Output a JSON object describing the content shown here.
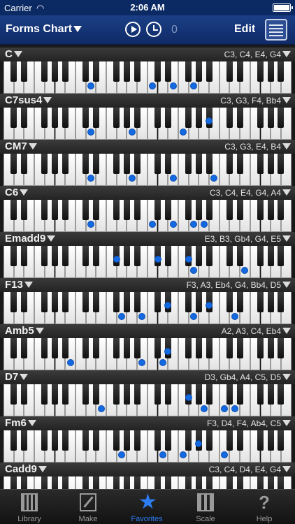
{
  "status_bar": {
    "carrier": "Carrier",
    "time": "2:06 AM"
  },
  "nav": {
    "title": "Forms Chart",
    "count": "0",
    "edit_label": "Edit"
  },
  "chords": [
    {
      "name": "C",
      "notes": "C3, C4, E4, G4",
      "keys": [
        14,
        24,
        28,
        31
      ]
    },
    {
      "name": "C7sus4",
      "notes": "C3, G3, F4, Bb4",
      "keys": [
        14,
        21,
        29,
        34
      ]
    },
    {
      "name": "CM7",
      "notes": "C3, G3, E4, B4",
      "keys": [
        14,
        21,
        28,
        35
      ]
    },
    {
      "name": "C6",
      "notes": "C3, C4, E4, G4, A4",
      "keys": [
        14,
        24,
        28,
        31,
        33
      ]
    },
    {
      "name": "Emadd9",
      "notes": "E3, B3, Gb4, G4, E5",
      "keys": [
        18,
        25,
        30,
        31,
        40
      ]
    },
    {
      "name": "F13",
      "notes": "F3, A3, Eb4, G4, Bb4, D5",
      "keys": [
        19,
        23,
        27,
        31,
        34,
        38
      ]
    },
    {
      "name": "Amb5",
      "notes": "A2, A3, C4, Eb4",
      "keys": [
        11,
        23,
        26,
        27
      ]
    },
    {
      "name": "D7",
      "notes": "D3, Gb4, A4, C5, D5",
      "keys": [
        16,
        30,
        33,
        36,
        38
      ]
    },
    {
      "name": "Fm6",
      "notes": "F3, D4, F4, Ab4, C5",
      "keys": [
        19,
        26,
        29,
        32,
        36
      ]
    },
    {
      "name": "Cadd9",
      "notes": "C3, C4, D4, E4, G4",
      "keys": [
        14,
        24,
        26,
        28,
        31
      ]
    }
  ],
  "tabs": [
    {
      "label": "Library",
      "icon": "library-icon"
    },
    {
      "label": "Make",
      "icon": "pencil-icon"
    },
    {
      "label": "Favorites",
      "icon": "star-icon",
      "active": true
    },
    {
      "label": "Scale",
      "icon": "scale-icon"
    },
    {
      "label": "Help",
      "icon": "question-icon"
    }
  ],
  "colors": {
    "accent": "#2d7cf2",
    "note_dot": "#1468e0",
    "nav_bg": "#143473"
  }
}
